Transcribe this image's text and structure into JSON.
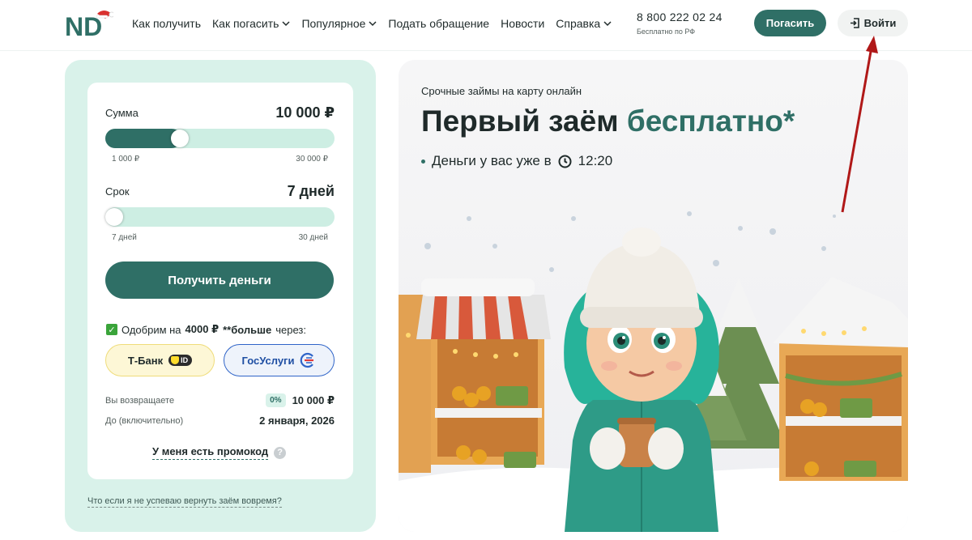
{
  "header": {
    "logo_text": "ND",
    "nav": [
      {
        "label": "Как получить",
        "has_dropdown": false
      },
      {
        "label": "Как погасить",
        "has_dropdown": true
      },
      {
        "label": "Популярное",
        "has_dropdown": true
      },
      {
        "label": "Подать обращение",
        "has_dropdown": false
      },
      {
        "label": "Новости",
        "has_dropdown": false
      },
      {
        "label": "Справка",
        "has_dropdown": true
      }
    ],
    "phone": "8 800 222 02 24",
    "phone_note": "Бесплатно по РФ",
    "pay_button": "Погасить",
    "login_button": "Войти"
  },
  "calculator": {
    "amount": {
      "label": "Сумма",
      "value": "10 000 ₽",
      "min": "1 000 ₽",
      "max": "30 000 ₽",
      "fill_fraction": 0.31
    },
    "term": {
      "label": "Срок",
      "value": "7 дней",
      "min": "7 дней",
      "max": "30 дней",
      "fill_fraction": 0.0
    },
    "get_money_button": "Получить деньги",
    "approve": {
      "prefix": "Одобрим на",
      "amount": "4000 ₽",
      "middle": "**больше",
      "suffix": "через:"
    },
    "tbank_button": "Т-Банк",
    "tbank_badge": "ID",
    "gosuslugi_button": "ГосУслуги",
    "return_label": "Вы возвращаете",
    "return_rate": "0%",
    "return_value": "10 000 ₽",
    "until_label": "До (включительно)",
    "until_value": "2 января, 2026",
    "promo": "У меня есть промокод",
    "promo_help": "?"
  },
  "late_link": "Что если я не успеваю вернуть заём вовремя?",
  "hero": {
    "subtitle": "Срочные займы на карту онлайн",
    "title_main": "Первый заём",
    "title_accent": "бесплатно*",
    "bullet": "Деньги у вас уже в",
    "bullet_time": "12:20"
  },
  "colors": {
    "brand": "#2f6f66",
    "panel": "#d9f2ea",
    "arrow": "#b01818"
  }
}
